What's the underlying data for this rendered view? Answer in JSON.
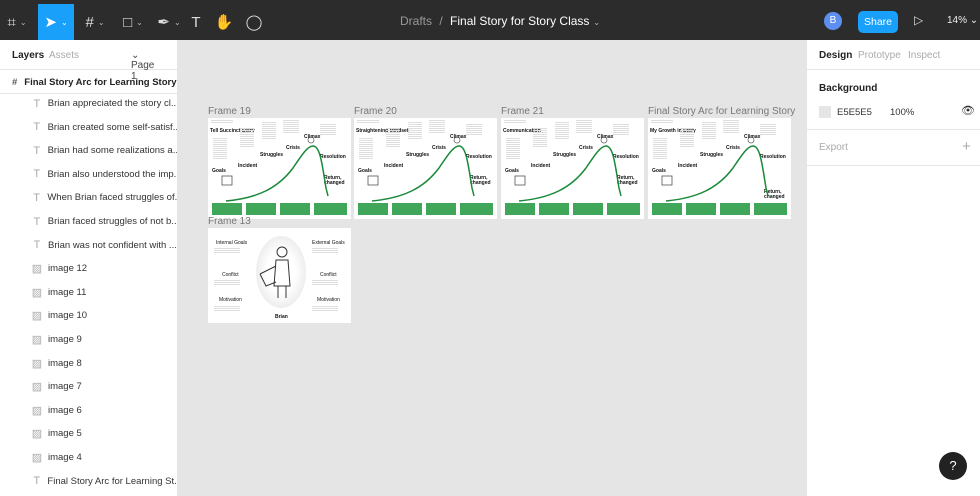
{
  "toolbar": {
    "tools": [
      "figma-menu-icon",
      "move-tool-icon",
      "frame-tool-icon",
      "rectangle-tool-icon",
      "pen-tool-icon",
      "text-tool-icon",
      "hand-tool-icon",
      "comment-tool-icon"
    ],
    "breadcrumb_root": "Drafts",
    "separator": "/",
    "file_name": "Final Story for Story Class",
    "avatar": "B",
    "share": "Share",
    "zoom": "14%",
    "accent": "#18a0fb"
  },
  "left_panel": {
    "tab_layers": "Layers",
    "tab_assets": "Assets",
    "page": "Page 1",
    "root_frame": "Final Story Arc for Learning Story",
    "layers": [
      {
        "type": "text",
        "label": "Brian appreciated the story cl..."
      },
      {
        "type": "text",
        "label": "Brian created some self-satisf..."
      },
      {
        "type": "text",
        "label": "Brian had some realizations a..."
      },
      {
        "type": "text",
        "label": "Brian also understood the imp..."
      },
      {
        "type": "text",
        "label": "When Brian faced struggles of..."
      },
      {
        "type": "text",
        "label": "Brian faced struggles of not b..."
      },
      {
        "type": "text",
        "label": "Brian was not confident with ..."
      },
      {
        "type": "image",
        "label": "image 12"
      },
      {
        "type": "image",
        "label": "image 11"
      },
      {
        "type": "image",
        "label": "image 10"
      },
      {
        "type": "image",
        "label": "image 9"
      },
      {
        "type": "image",
        "label": "image 8"
      },
      {
        "type": "image",
        "label": "image 7"
      },
      {
        "type": "image",
        "label": "image 6"
      },
      {
        "type": "image",
        "label": "image 5"
      },
      {
        "type": "image",
        "label": "image 4"
      },
      {
        "type": "text",
        "label": "Final Story Arc for Learning St..."
      }
    ]
  },
  "right_panel": {
    "tab_design": "Design",
    "tab_prototype": "Prototype",
    "tab_inspect": "Inspect",
    "background_label": "Background",
    "bg_hex": "E5E5E5",
    "bg_color": "#e5e5e5",
    "opacity": "100%",
    "export_label": "Export"
  },
  "canvas": {
    "arc_frames": [
      {
        "name": "Frame 19",
        "heading": "Tell Succinct Story"
      },
      {
        "name": "Frame 20",
        "heading": "Straightening Mindset"
      },
      {
        "name": "Frame 21",
        "heading": "Communication"
      },
      {
        "name": "Final Story Arc for Learning Story",
        "heading": "My Growth in Story"
      }
    ],
    "arc_labels": {
      "goals": "Goals",
      "incident": "Incident",
      "struggles": "Struggles",
      "crisis": "Crisis",
      "climax": "Climax",
      "resolution": "Resolution",
      "return": "Return, changed"
    },
    "character_frame": {
      "name": "Frame 13",
      "internal": "Internal Goals",
      "external": "External Goals",
      "conflict": "Conflict",
      "motivation": "Motivation",
      "character": "Brian"
    }
  },
  "help": "?"
}
